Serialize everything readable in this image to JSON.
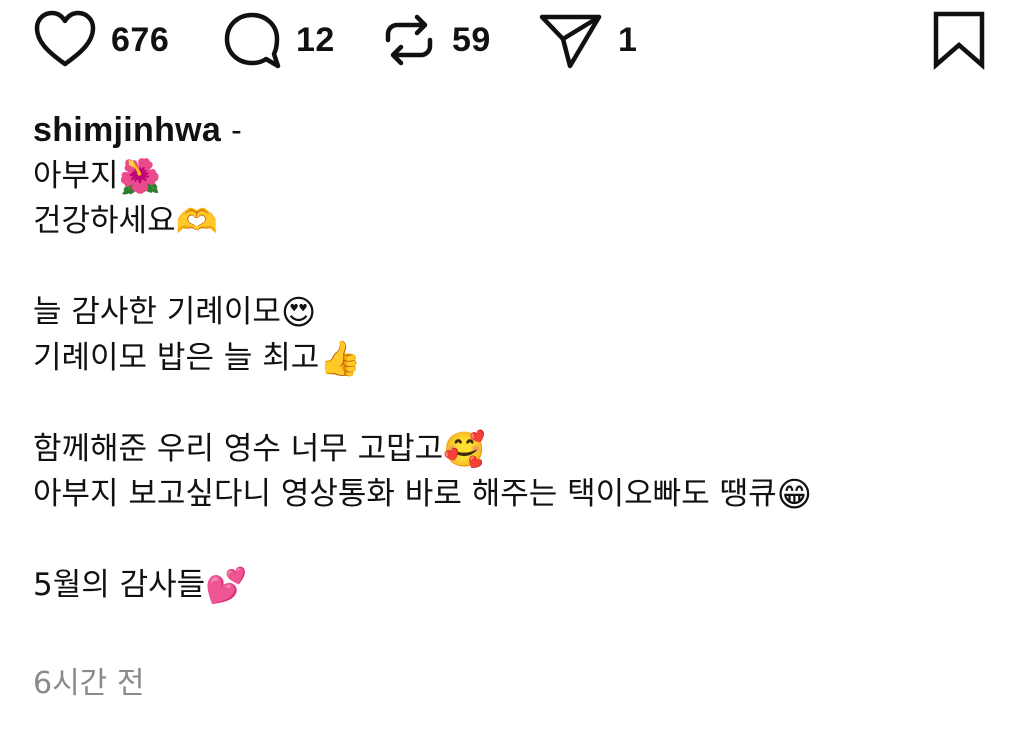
{
  "actions": {
    "like": {
      "icon": "heart-icon",
      "count": "676"
    },
    "comment": {
      "icon": "comment-bubble-icon",
      "count": "12"
    },
    "repost": {
      "icon": "repost-arrows-icon",
      "count": "59"
    },
    "share": {
      "icon": "send-paper-plane-icon",
      "count": "1"
    },
    "bookmark": {
      "icon": "bookmark-icon"
    }
  },
  "caption": {
    "username": "shimjinhwa",
    "separator": "-",
    "lines": [
      {
        "text": "아부지",
        "emoji": "🌺"
      },
      {
        "text": "건강하세요",
        "emoji": "🫶"
      },
      {
        "text": "",
        "emoji": ""
      },
      {
        "text": "늘 감사한 기례이모",
        "emoji": "😍"
      },
      {
        "text": "기례이모 밥은 늘 최고",
        "emoji": "👍"
      },
      {
        "text": "",
        "emoji": ""
      },
      {
        "text": "함께해준 우리 영수 너무 고맙고",
        "emoji": "🥰"
      },
      {
        "text": "아부지 보고싶다니 영상통화 바로 해주는 택이오빠도 땡큐",
        "emoji": "😁"
      },
      {
        "text": "",
        "emoji": ""
      },
      {
        "text": "5월의 감사들",
        "emoji": "💕"
      }
    ]
  },
  "timestamp": "6시간 전",
  "colors": {
    "text": "#111111",
    "muted": "#8a8a8a",
    "background": "#ffffff"
  }
}
